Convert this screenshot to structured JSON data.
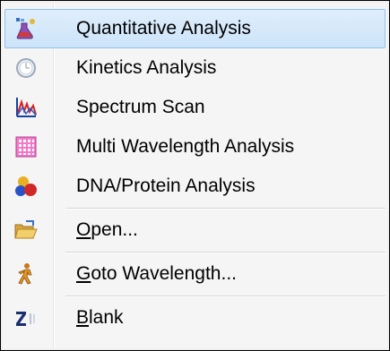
{
  "menu": {
    "items": [
      {
        "label": "Quantitative Analysis",
        "icon": "quantitative-analysis-icon",
        "selected": true
      },
      {
        "label": "Kinetics Analysis",
        "icon": "kinetics-analysis-icon",
        "selected": false
      },
      {
        "label": "Spectrum Scan",
        "icon": "spectrum-scan-icon",
        "selected": false
      },
      {
        "label": "Multi Wavelength Analysis",
        "icon": "multi-wavelength-icon",
        "selected": false
      },
      {
        "label": "DNA/Protein Analysis",
        "icon": "dna-protein-icon",
        "selected": false
      },
      {
        "label": "Open...",
        "mnemonic": "O",
        "rest": "pen...",
        "icon": "open-folder-icon",
        "selected": false
      },
      {
        "label": "Goto Wavelength...",
        "mnemonic": "G",
        "rest": "oto Wavelength...",
        "icon": "goto-wavelength-icon",
        "selected": false
      },
      {
        "label": "Blank",
        "mnemonic": "B",
        "rest": "lank",
        "icon": "blank-icon",
        "selected": false
      }
    ]
  },
  "colors": {
    "selection_fill": "#cce4f9",
    "selection_border": "#90c0ea",
    "menu_background": "#f5f5f5"
  }
}
